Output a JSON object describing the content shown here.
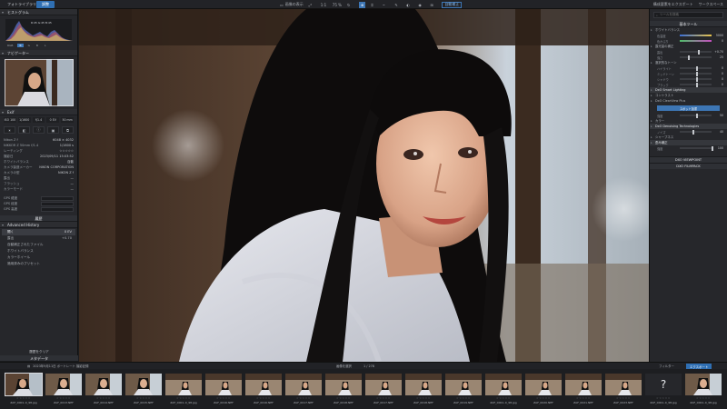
{
  "topbar": {
    "tabs": [
      {
        "label": "フォトライブラリ"
      },
      {
        "label": "調整"
      }
    ],
    "tools": [
      {
        "label": "画像の表示"
      },
      {
        "label": "1:1"
      },
      {
        "label": "75 %"
      },
      {
        "label": "自動補正"
      }
    ],
    "right": {
      "export_label": "構成要素をエクスポート",
      "workspace_label": "ワークスペース"
    }
  },
  "left": {
    "histogram_title": "ヒストグラム",
    "hist_readout": "R:45  G:45  B:45",
    "hist_modes": [
      "RGB",
      "R",
      "G",
      "B",
      "L"
    ],
    "navigator_title": "ナビゲーター",
    "exif_title": "Exif",
    "exif_chips": [
      "ISO 100",
      "1/1600",
      "f/1.4",
      "0 EV",
      "50 mm"
    ],
    "exif_rows": [
      {
        "label": "Nikon Z f",
        "value": "6048 × 4032"
      },
      {
        "label": "NIKKOR Z 50mm f/1.4",
        "value": "1/1600 s"
      },
      {
        "label": "レーティング",
        "value": ""
      },
      {
        "label": "撮影日",
        "value": "2023/09/11 15:03:52"
      },
      {
        "label": "ホワイトバランス",
        "value": "自動"
      },
      {
        "label": "カメラ製造メーカー",
        "value": "NIKON CORPORATION"
      },
      {
        "label": "カメラの型",
        "value": "NIKON Z f"
      },
      {
        "label": "露出",
        "value": "—"
      },
      {
        "label": "フラッシュ",
        "value": "—"
      },
      {
        "label": "カラーモード",
        "value": "—"
      }
    ],
    "gps_rows": [
      "GPS 緯度",
      "GPS 経度",
      "GPS 高度"
    ],
    "panel2_title": "履歴",
    "history_title": "Advanced History",
    "history_items": [
      {
        "label": "開く",
        "value": "0 EV"
      },
      {
        "label": "露出",
        "value": "+0.70"
      },
      {
        "label": "自動補正されたファイル",
        "value": ""
      },
      {
        "label": "ホワイトバランス",
        "value": ""
      },
      {
        "label": "カラーホイール",
        "value": ""
      },
      {
        "label": "適用済みのプリセット",
        "value": ""
      }
    ],
    "history_button": "履歴をクリア",
    "footer": "メタデータ"
  },
  "right": {
    "search_placeholder": "ツールを検索",
    "main_title": "基本ツール",
    "sections": [
      {
        "label": "ホワイトバランス",
        "hl": false
      },
      {
        "label": "露光量の補正",
        "hl": false
      },
      {
        "label": "DxO Smart Lighting",
        "hl": true
      },
      {
        "label": "選択的なトーン",
        "hl": false
      },
      {
        "label": "コントラスト",
        "hl": false
      },
      {
        "label": "DxO ClearView Plus",
        "hl": false
      },
      {
        "label": "カラー",
        "hl": false
      },
      {
        "label": "DxO Denoising Technologies",
        "hl": true
      },
      {
        "label": "シャープネス",
        "hl": false
      },
      {
        "label": "歪み補正",
        "hl": true
      }
    ],
    "sliders": [
      {
        "label": "色温度",
        "value": "5000"
      },
      {
        "label": "色かぶり",
        "value": "0"
      },
      {
        "label": "露出",
        "value": "+0.70"
      },
      {
        "label": "強さ",
        "value": "25"
      },
      {
        "label": "ハイライト",
        "value": "0"
      },
      {
        "label": "ミッドトーン",
        "value": "0"
      },
      {
        "label": "シャドウ",
        "value": "0"
      },
      {
        "label": "ブラック",
        "value": "0"
      },
      {
        "label": "強度",
        "value": "50"
      },
      {
        "label": "ノイズ",
        "value": "40"
      },
      {
        "label": "強度",
        "value": "100"
      }
    ],
    "mode_button": "スポット加重",
    "viewpoint_label": "DXO VIEWPOINT",
    "filmpack_label": "DXO FILMPACK"
  },
  "film": {
    "folder": "2023年9月11日 ポートレート 撮影記録",
    "count_label": "画像を選択",
    "count_value": "1 / 278",
    "filter": "フィルター",
    "export_label": "エクスポート",
    "items": [
      {
        "name": "ZAF_0001–0_98.jpg"
      },
      {
        "name": "ZAF_0013.NEF"
      },
      {
        "name": "ZAF_0014.NEF"
      },
      {
        "name": "ZAF_0015.NEF"
      },
      {
        "name": "ZAF_0001–0_98.jpg"
      },
      {
        "name": "ZAF_0016.NEF"
      },
      {
        "name": "ZAF_0016.NEF"
      },
      {
        "name": "ZAF_0017.NEF"
      },
      {
        "name": "ZAF_0018.NEF"
      },
      {
        "name": "ZAF_0017.NEF"
      },
      {
        "name": "ZAF_0018.NEF"
      },
      {
        "name": "ZAF_0019.NEF"
      },
      {
        "name": "ZAF_0001–0_98.jpg"
      },
      {
        "name": "ZAF_0020.NEF"
      },
      {
        "name": "ZAF_0021.NEF"
      },
      {
        "name": "ZAF_0023.NEF"
      },
      {
        "name": "ZAF_0001–0_98.jpg"
      },
      {
        "name": "ZAF_0001–0_98.jpg"
      }
    ]
  }
}
